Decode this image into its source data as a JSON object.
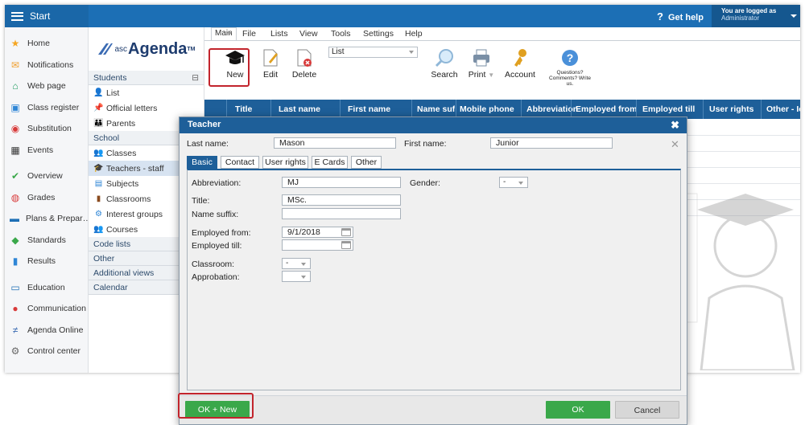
{
  "topbar": {
    "start_label": "Start",
    "help_label": "Get help",
    "help_icon": "?",
    "logged_label": "You are logged as",
    "logged_user": "Administrator"
  },
  "left_nav": [
    {
      "icon": "star-icon",
      "label": "Home",
      "color": "#f5a623"
    },
    {
      "icon": "envelope-icon",
      "label": "Notifications",
      "color": "#f0a030"
    },
    {
      "icon": "house-icon",
      "label": "Web page",
      "color": "#1b9a5c"
    },
    {
      "icon": "register-icon",
      "label": "Class register",
      "color": "#2f86d6"
    },
    {
      "icon": "substitution-icon",
      "label": "Substitution",
      "color": "#d83a3a"
    },
    {
      "icon": "calendar-icon",
      "label": "Events",
      "color": "#333"
    },
    {
      "icon": "check-circle-icon",
      "label": "Overview",
      "color": "#3aa84a"
    },
    {
      "icon": "grades-icon",
      "label": "Grades",
      "color": "#d83a3a"
    },
    {
      "icon": "briefcase-icon",
      "label": "Plans & Prepar…",
      "color": "#1e6fb5"
    },
    {
      "icon": "shield-icon",
      "label": "Standards",
      "color": "#3aa84a"
    },
    {
      "icon": "bar-chart-icon",
      "label": "Results",
      "color": "#2f86d6"
    },
    {
      "icon": "book-icon",
      "label": "Education",
      "color": "#1e6fb5"
    },
    {
      "icon": "chat-icon",
      "label": "Communication",
      "color": "#d83a3a"
    },
    {
      "icon": "asc-logo-icon",
      "label": "Agenda Online",
      "color": "#3b6bb3"
    },
    {
      "icon": "gear-icon",
      "label": "Control center",
      "color": "#666"
    }
  ],
  "subnav": {
    "logo_text": "Agenda",
    "logo_prefix": "asc",
    "logo_tm": "TM",
    "sections": {
      "students": "Students",
      "school": "School",
      "code_lists": "Code lists",
      "other": "Other",
      "additional_views": "Additional views",
      "calendar": "Calendar"
    },
    "students_items": [
      "List",
      "Official letters",
      "Parents"
    ],
    "school_items": [
      "Classes",
      "Teachers - staff",
      "Subjects",
      "Classrooms",
      "Interest groups",
      "Courses"
    ],
    "collapse_symbol": "⊟"
  },
  "ribbon": {
    "tabs": [
      "Main",
      "File",
      "Lists",
      "View",
      "Tools",
      "Settings",
      "Help"
    ],
    "buttons": {
      "new": "New",
      "edit": "Edit",
      "delete": "Delete",
      "search": "Search",
      "print": "Print",
      "account": "Account",
      "questions": "Questions? Comments? Write us."
    },
    "list_select": "List"
  },
  "grid": {
    "columns": [
      "Title",
      "Last name",
      "First name",
      "Name suffix",
      "Mobile phone",
      "Abbreviation",
      "Employed from",
      "Employed till",
      "User rights",
      "Other - Icons"
    ]
  },
  "dialog": {
    "title": "Teacher",
    "close_symbol": "✖",
    "last_name_label": "Last name:",
    "last_name_value": "Mason",
    "first_name_label": "First name:",
    "first_name_value": "Junior",
    "tabs": [
      "Basic",
      "Contact",
      "User rights",
      "E Cards",
      "Other"
    ],
    "abbreviation_label": "Abbreviation:",
    "abbreviation_value": "MJ",
    "gender_label": "Gender:",
    "gender_value": "-",
    "title_label": "Title:",
    "title_value": "MSc.",
    "name_suffix_label": "Name suffix:",
    "name_suffix_value": "",
    "employed_from_label": "Employed from:",
    "employed_from_value": "9/1/2018",
    "employed_till_label": "Employed till:",
    "employed_till_value": "",
    "classroom_label": "Classroom:",
    "classroom_value": "-",
    "approbation_label": "Approbation:",
    "approbation_value": "",
    "ok_new_label": "OK + New",
    "ok_label": "OK",
    "cancel_label": "Cancel"
  }
}
